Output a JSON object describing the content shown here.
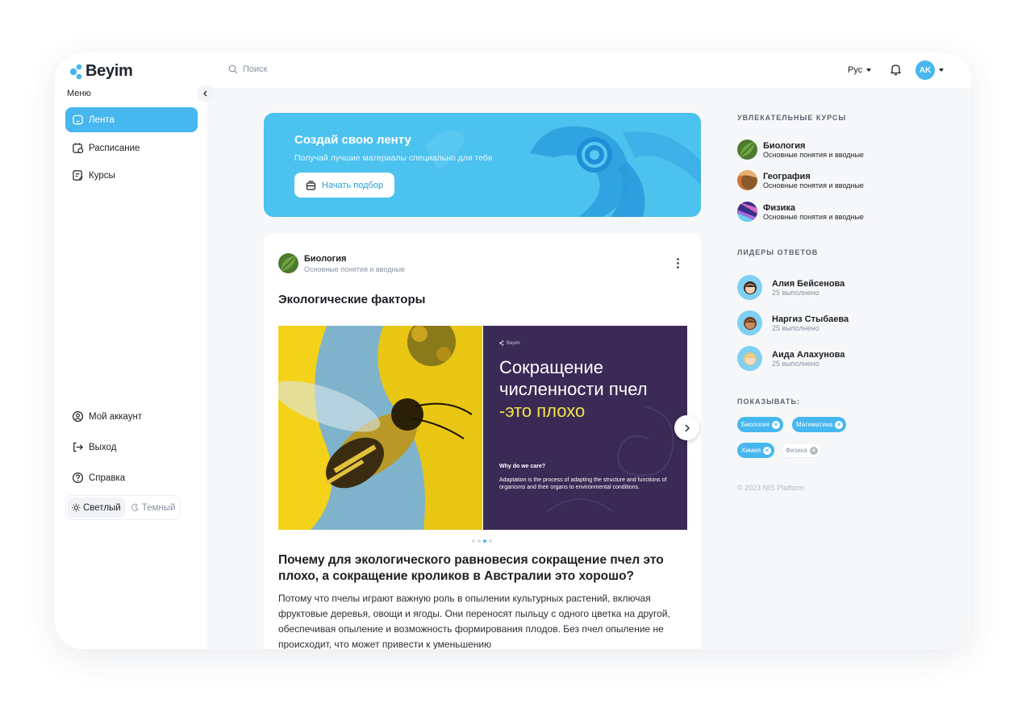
{
  "app": {
    "name": "Beyim"
  },
  "sidebar": {
    "menu_caption": "Меню",
    "items": [
      {
        "label": "Лента",
        "icon": "home-icon",
        "active": true
      },
      {
        "label": "Расписание",
        "icon": "calendar-icon"
      },
      {
        "label": "Курсы",
        "icon": "courses-icon"
      }
    ],
    "bottom": [
      {
        "label": "Мой аккаунт",
        "icon": "user-circle-icon"
      },
      {
        "label": "Выход",
        "icon": "logout-icon"
      },
      {
        "label": "Справка",
        "icon": "help-icon"
      }
    ],
    "theme": {
      "light": "Светлый",
      "dark": "Темный",
      "selected": "light"
    }
  },
  "topbar": {
    "search_placeholder": "Поиск",
    "language": "Рус",
    "avatar_initials": "AK"
  },
  "banner": {
    "title": "Создай свою ленту",
    "subtitle": "Получай лучшие материалы специально для тебя",
    "button": "Начать подбор"
  },
  "post": {
    "course": "Биология",
    "course_sub": "Основные понятия и вводные",
    "title": "Экологические факторы",
    "slide": {
      "brand": "Beyim",
      "heading_1": "Сокращение",
      "heading_2": "численности пчел",
      "heading_3": "-это плохо",
      "question": "Why do we care?",
      "answer": "Adaptation is the process of adapting the structure and functions of organisms and their organs to environmental conditions."
    },
    "carousel": {
      "count": 4,
      "current": 3
    },
    "headline": "Почему для экологического равновесия сокращение пчел это плохо, а сокращение кроликов в Австралии это хорошо?",
    "body": "Потому что пчелы играют важную роль в опылении культурных растений, включая фруктовые деревья, овощи и ягоды. Они переносят пыльцу с одного цветка на другой, обеспечивая опыление и возможность формирования плодов.  Без пчел опыление не происходит, что может привести к уменьшению"
  },
  "right": {
    "courses_caption": "УВЛЕКАТЕЛЬНЫЕ КУРСЫ",
    "courses": [
      {
        "title": "Биология",
        "subtitle": "Основные понятия и вводные"
      },
      {
        "title": "География",
        "subtitle": "Основные понятия и вводные"
      },
      {
        "title": "Физика",
        "subtitle": "Основные понятия и вводные"
      }
    ],
    "leaders_caption": "ЛИДЕРЫ ОТВЕТОВ",
    "leaders": [
      {
        "name": "Алия Бейсенова",
        "done": "25 выполнено"
      },
      {
        "name": "Наргиз Стыбаева",
        "done": "25 выполнено"
      },
      {
        "name": "Аида Алахунова",
        "done": "25 выполнено"
      }
    ],
    "filter_caption": "ПОКАЗЫВАТЬ:",
    "filters": [
      {
        "label": "Биология",
        "active": true
      },
      {
        "label": "Математика",
        "active": true
      },
      {
        "label": "Химия",
        "active": true
      },
      {
        "label": "Физика",
        "active": false
      }
    ],
    "copyright": "© 2023 NIS Platform"
  },
  "colors": {
    "accent": "#47b7ef",
    "banner": "#4cc2ee",
    "slide_bg": "#3a2a55",
    "slide_highlight": "#f2e34b"
  }
}
